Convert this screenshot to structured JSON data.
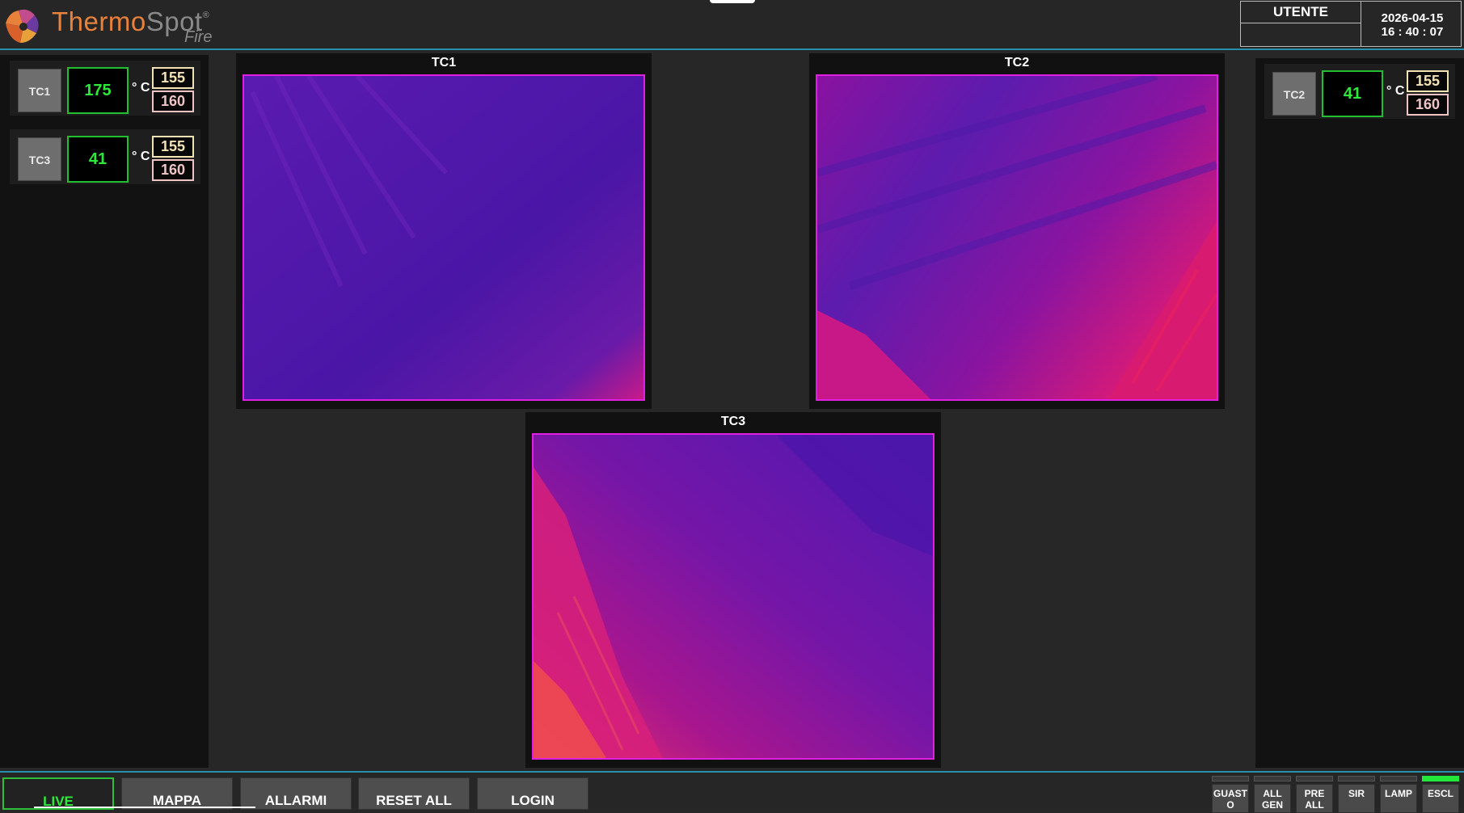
{
  "header": {
    "brand_thermo": "Thermo",
    "brand_spot": "Spot",
    "brand_registered": "®",
    "brand_sub": "Fire",
    "user_label": "UTENTE",
    "user_value": "",
    "date": "2026-04-15",
    "time": "16 : 40 : 07"
  },
  "sensors_left": [
    {
      "label": "TC1",
      "value": "175",
      "unit": "° C",
      "pre_alarm": "155",
      "alarm": "160"
    },
    {
      "label": "TC3",
      "value": "41",
      "unit": "° C",
      "pre_alarm": "155",
      "alarm": "160"
    }
  ],
  "sensors_right": [
    {
      "label": "TC2",
      "value": "41",
      "unit": "° C",
      "pre_alarm": "155",
      "alarm": "160"
    }
  ],
  "cameras": [
    {
      "title": "TC1"
    },
    {
      "title": "TC2"
    },
    {
      "title": "TC3"
    }
  ],
  "nav_buttons": [
    "LIVE",
    "MAPPA",
    "ALLARMI",
    "RESET ALL",
    "LOGIN"
  ],
  "indicators": [
    {
      "label": "GUAST O",
      "active": false
    },
    {
      "label": "ALL GEN",
      "active": false
    },
    {
      "label": "PRE ALL GEN",
      "active": false
    },
    {
      "label": "SIR",
      "active": false
    },
    {
      "label": "LAMP",
      "active": false
    },
    {
      "label": "ESCL",
      "active": true
    }
  ],
  "colors": {
    "accent_line": "#2a8fa8",
    "value_green": "#2ee83a",
    "pre_alarm": "#f3e3b4",
    "alarm": "#f0c4c4",
    "camera_border": "#e020e0"
  }
}
